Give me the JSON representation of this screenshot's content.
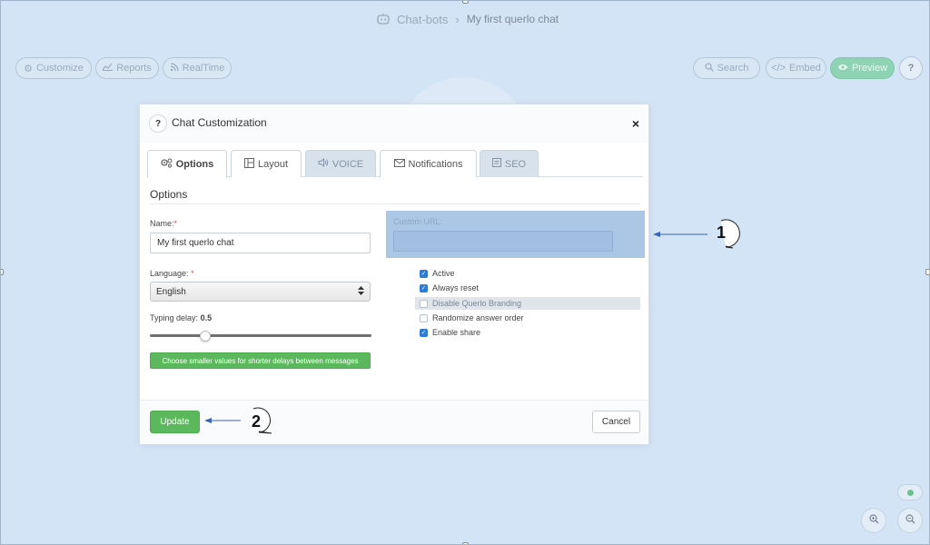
{
  "breadcrumb": {
    "icon": "robot-icon",
    "parent": "Chat-bots",
    "separator": "›",
    "current": "My first querlo chat"
  },
  "toolbar": {
    "customize": "Customize",
    "reports": "Reports",
    "realtime": "RealTime",
    "search": "Search",
    "embed": "Embed",
    "preview": "Preview",
    "help": "?"
  },
  "modal": {
    "help": "?",
    "title": "Chat Customization",
    "close": "×",
    "tabs": [
      {
        "label": "Options",
        "icon": "gears-icon",
        "state": "active"
      },
      {
        "label": "Layout",
        "icon": "layout-icon",
        "state": "normal"
      },
      {
        "label": "VOICE",
        "icon": "speaker-icon",
        "state": "disabled"
      },
      {
        "label": "Notifications",
        "icon": "envelope-icon",
        "state": "normal"
      },
      {
        "label": "SEO",
        "icon": "document-icon",
        "state": "disabled"
      }
    ],
    "section_title": "Options",
    "name": {
      "label": "Name:",
      "required": "*",
      "value": "My first querlo chat"
    },
    "language": {
      "label": "Language:",
      "required": "*",
      "value": "English"
    },
    "typing_delay": {
      "label": "Typing delay:",
      "value": "0.5",
      "fraction": 0.25
    },
    "hint": "Choose smaller values for shorter delays between messages",
    "custom_url": {
      "label": "Custom URL:",
      "value": ""
    },
    "checkboxes": [
      {
        "label": "Active",
        "checked": true,
        "disabled": false
      },
      {
        "label": "Always reset",
        "checked": true,
        "disabled": false
      },
      {
        "label": "Disable Querlo Branding",
        "checked": false,
        "disabled": true
      },
      {
        "label": "Randomize answer order",
        "checked": false,
        "disabled": false
      },
      {
        "label": "Enable share",
        "checked": true,
        "disabled": false
      }
    ],
    "update": "Update",
    "cancel": "Cancel"
  },
  "annotations": {
    "one": "1",
    "two": "2"
  },
  "colors": {
    "background": "#d3e4f6",
    "primary_green": "#5cb85c",
    "preview_green": "#8fd3b5",
    "checkbox_blue": "#2e7bd6",
    "highlight": "#a9c4e5"
  }
}
